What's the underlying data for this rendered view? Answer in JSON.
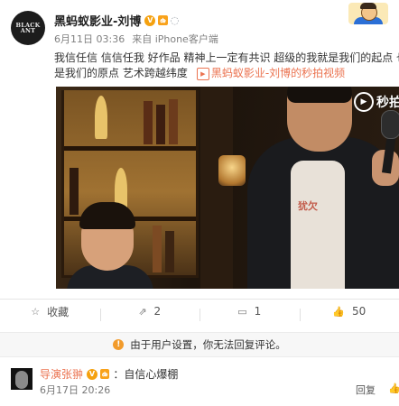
{
  "post": {
    "avatar_text": "BLACK ANT",
    "author": "黑蚂蚁影业-刘博",
    "badge_text": "V",
    "tag_text": "ఉ",
    "time": "6月11日 03:36",
    "source": "来自 iPhone客户端",
    "text_line1": "我信任信 信信任我 好作品 精神上一定有共识 超级的我就是我们的起点 也",
    "text_line2": "是我们的原点 艺术跨越纬度",
    "video_link": "黑蚂蚁影业-刘博的秒拍视频",
    "video_watermark": "秒拍",
    "tee_text": "犹欠"
  },
  "actions": [
    {
      "icon": "star-icon",
      "glyph": "☆",
      "label": "收藏"
    },
    {
      "icon": "share-icon",
      "glyph": "⇗",
      "label": "2"
    },
    {
      "icon": "comment-icon",
      "glyph": "▭",
      "label": "1"
    },
    {
      "icon": "like-icon",
      "glyph": "👍",
      "label": "50"
    }
  ],
  "notice": {
    "text": "由于用户设置，你无法回复评论。"
  },
  "comment": {
    "user": "导演张翀",
    "badge_text": "V",
    "text": "：自信心爆棚",
    "time": "6月17日 20:26",
    "reply_label": "回复",
    "like_glyph": "👍"
  }
}
